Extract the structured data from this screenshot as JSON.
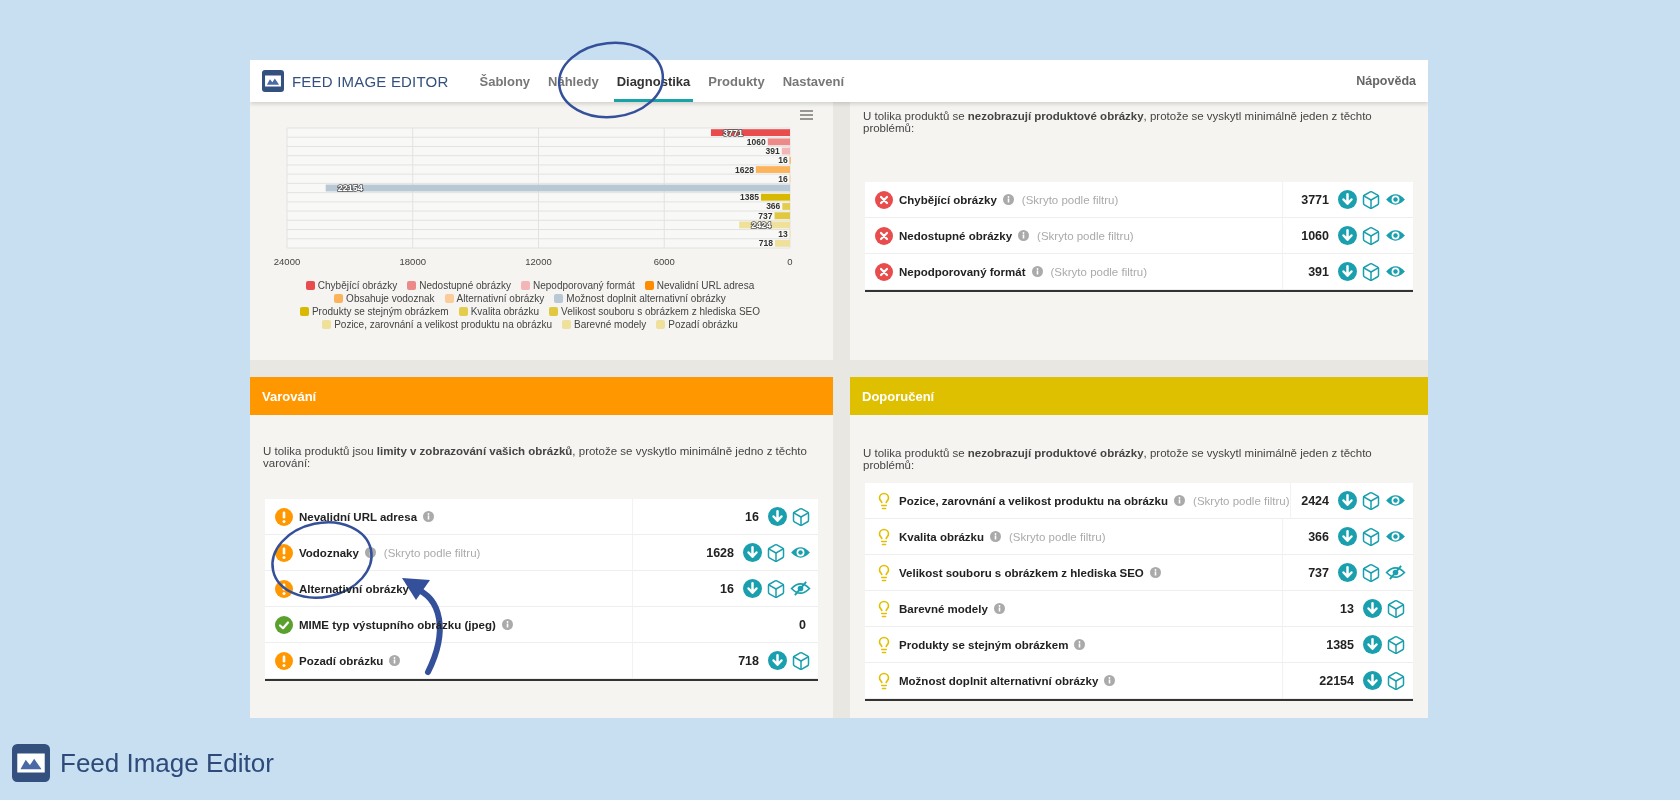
{
  "header": {
    "logo_text": "FEED IMAGE EDITOR",
    "nav": [
      {
        "label": "Šablony",
        "selected": false
      },
      {
        "label": "Náhledy",
        "selected": false
      },
      {
        "label": "Diagnostika",
        "selected": true
      },
      {
        "label": "Produkty",
        "selected": false
      },
      {
        "label": "Nastavení",
        "selected": false
      }
    ],
    "help": "Nápověda"
  },
  "chart_panel": {
    "chart_data": {
      "type": "bar",
      "orientation": "horizontal",
      "stacked": true,
      "grid": true,
      "data_labels": true,
      "xlim": [
        24000,
        0
      ],
      "xticks": [
        24000,
        18000,
        12000,
        6000,
        0
      ],
      "series": [
        {
          "name": "Chybějící obrázky",
          "color": "#e84c4c",
          "values": [
            3771,
            null,
            null,
            null,
            null,
            null,
            null,
            null,
            null,
            null,
            null,
            null,
            null
          ]
        },
        {
          "name": "Nedostupné obrázky",
          "color": "#ec8a8a",
          "values": [
            null,
            1060,
            null,
            null,
            null,
            null,
            null,
            null,
            null,
            null,
            null,
            null,
            null
          ]
        },
        {
          "name": "Nepodporovaný formát",
          "color": "#f3b5b5",
          "values": [
            null,
            null,
            391,
            null,
            null,
            null,
            null,
            null,
            null,
            null,
            null,
            null,
            null
          ]
        },
        {
          "name": "Nevalidní URL adresa",
          "color": "#ff8c00",
          "values": [
            null,
            null,
            null,
            16,
            null,
            null,
            null,
            null,
            null,
            null,
            null,
            null,
            null
          ]
        },
        {
          "name": "Obsahuje vodoznak",
          "color": "#fcb45c",
          "values": [
            null,
            null,
            null,
            null,
            1628,
            null,
            null,
            null,
            null,
            null,
            null,
            null,
            null
          ]
        },
        {
          "name": "Alternativní obrázky",
          "color": "#fbcb9a",
          "values": [
            null,
            null,
            null,
            null,
            null,
            16,
            null,
            null,
            null,
            null,
            null,
            null,
            null
          ]
        },
        {
          "name": "Možnost doplnit alternativní obrázky",
          "color": "#b8c8d4",
          "values": [
            null,
            null,
            null,
            null,
            null,
            null,
            22154,
            null,
            null,
            null,
            null,
            null,
            null
          ]
        },
        {
          "name": "Produkty se stejným obrázkem",
          "color": "#d9b800",
          "values": [
            null,
            null,
            null,
            null,
            null,
            null,
            null,
            1385,
            null,
            null,
            null,
            null,
            null
          ]
        },
        {
          "name": "Kvalita obrázku",
          "color": "#e4cc4c",
          "values": [
            null,
            null,
            null,
            null,
            null,
            null,
            null,
            null,
            366,
            null,
            null,
            null,
            null
          ]
        },
        {
          "name": "Velikost souboru s obrázkem z hlediska SEO",
          "color": "#e0c840",
          "values": [
            null,
            null,
            null,
            null,
            null,
            null,
            null,
            null,
            null,
            737,
            null,
            null,
            null
          ]
        },
        {
          "name": "Pozice, zarovnání a velikost produktu na obrázku",
          "color": "#efe09a",
          "values": [
            null,
            null,
            null,
            null,
            null,
            null,
            null,
            null,
            null,
            null,
            2424,
            null,
            null
          ]
        },
        {
          "name": "Barevné modely",
          "color": "#efe09b",
          "values": [
            null,
            null,
            null,
            null,
            null,
            null,
            null,
            null,
            null,
            null,
            null,
            13,
            null
          ]
        },
        {
          "name": "Pozadí obrázku",
          "color": "#efe09c",
          "values": [
            null,
            null,
            null,
            null,
            null,
            null,
            null,
            null,
            null,
            null,
            null,
            null,
            718
          ]
        }
      ]
    }
  },
  "problems_panel": {
    "description": "U tolika produktů se **nezobrazují produktové obrázky**, protože se vyskytl minimálně jeden z těchto problémů:",
    "rows": [
      {
        "kind": "error",
        "label": "Chybějící obrázky",
        "info": true,
        "note": "(Skryto podle filtru)",
        "count": "3771",
        "download": true,
        "cube": true,
        "eye": true,
        "eye_crossed": false
      },
      {
        "kind": "error",
        "label": "Nedostupné obrázky",
        "info": true,
        "note": "(Skryto podle filtru)",
        "count": "1060",
        "download": true,
        "cube": true,
        "eye": true,
        "eye_crossed": false
      },
      {
        "kind": "error",
        "label": "Nepodporovaný formát",
        "info": true,
        "note": "(Skryto podle filtru)",
        "count": "391",
        "download": true,
        "cube": true,
        "eye": true,
        "eye_crossed": false
      }
    ]
  },
  "warnings_panel": {
    "title": "Varování",
    "description": "U tolika produktů jsou **limity v zobrazování vašich obrázků**, protože se vyskytlo minimálně jedno z těchto varování:",
    "rows": [
      {
        "kind": "warning",
        "label": "Nevalidní URL adresa",
        "info": true,
        "count": "16",
        "download": true,
        "cube": true,
        "eye": false
      },
      {
        "kind": "warning",
        "label": "Vodoznaky",
        "info": true,
        "note": "(Skryto podle filtru)",
        "count": "1628",
        "download": true,
        "cube": true,
        "eye": true,
        "eye_crossed": false
      },
      {
        "kind": "warning",
        "label": "Alternativní obrázky",
        "info": false,
        "count": "16",
        "download": true,
        "cube": true,
        "eye": true,
        "eye_crossed": true
      },
      {
        "kind": "ok",
        "label": "MIME typ výstupního obrázku (jpeg)",
        "info": true,
        "count": "0",
        "download": false,
        "cube": false,
        "eye": false
      },
      {
        "kind": "warning",
        "label": "Pozadí obrázku",
        "info": true,
        "count": "718",
        "download": true,
        "cube": true,
        "eye": false
      }
    ]
  },
  "recommendations_panel": {
    "title": "Doporučení",
    "description": "U tolika produktů se **nezobrazují produktové obrázky**, protože se vyskytl minimálně jeden z těchto problémů:",
    "rows": [
      {
        "kind": "tip",
        "label": "Pozice, zarovnání a velikost produktu na obrázku",
        "info": true,
        "note": "(Skryto podle filtru)",
        "count": "2424",
        "download": true,
        "cube": true,
        "eye": true,
        "eye_crossed": false
      },
      {
        "kind": "tip",
        "label": "Kvalita obrázku",
        "info": true,
        "note": "(Skryto podle filtru)",
        "count": "366",
        "download": true,
        "cube": true,
        "eye": true,
        "eye_crossed": false
      },
      {
        "kind": "tip",
        "label": "Velikost souboru s obrázkem z hlediska SEO",
        "info": true,
        "count": "737",
        "download": true,
        "cube": true,
        "eye": true,
        "eye_crossed": true
      },
      {
        "kind": "tip",
        "label": "Barevné modely",
        "info": true,
        "count": "13",
        "download": true,
        "cube": true,
        "eye": false
      },
      {
        "kind": "tip",
        "label": "Produkty se stejným obrázkem",
        "info": true,
        "count": "1385",
        "download": true,
        "cube": true,
        "eye": false
      },
      {
        "kind": "tip",
        "label": "Možnost doplnit alternativní obrázky",
        "info": true,
        "count": "22154",
        "download": true,
        "cube": true,
        "eye": false
      }
    ]
  },
  "footer": {
    "brand": "Feed Image Editor"
  }
}
